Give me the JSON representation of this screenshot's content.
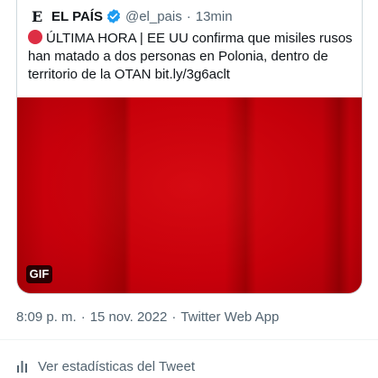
{
  "quoted_tweet": {
    "logo_letter": "E",
    "author_name": "EL PAÍS",
    "handle": "@el_pais",
    "separator": "·",
    "time": "13min",
    "text": "ÚLTIMA HORA | EE UU confirma que misiles rusos han matado a dos personas en Polonia, dentro de territorio de la OTAN bit.ly/3g6aclt",
    "media_badge": "GIF",
    "colors": {
      "media_red": "#c8000b",
      "verified_blue": "#1d9bf0",
      "alert_dot": "#dd2e44"
    }
  },
  "meta": {
    "time": "8:09 p. m.",
    "separator": "·",
    "date": "15 nov. 2022",
    "source": "Twitter Web App"
  },
  "stats": {
    "icon": "bar-chart-icon",
    "label": "Ver estadísticas del Tweet"
  }
}
